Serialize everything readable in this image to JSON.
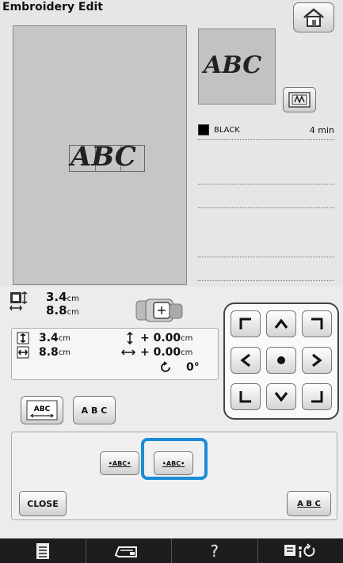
{
  "window": {
    "title": "Embroidery Edit"
  },
  "canvas": {
    "pattern_text": "ABC"
  },
  "preview": {
    "pattern_text": "ABC"
  },
  "thread_colors": [
    {
      "name": "BLACK",
      "time": "4 min",
      "color": "#000000"
    }
  ],
  "size_display": {
    "height_value": "3.4",
    "height_unit": "cm",
    "width_value": "8.8",
    "width_unit": "cm"
  },
  "edit_info": {
    "height_value": "3.4",
    "height_unit": "cm",
    "width_value": "8.8",
    "width_unit": "cm",
    "offset_v": "+ 0.00",
    "offset_v_unit": "cm",
    "offset_h": "+ 0.00",
    "offset_h_unit": "cm",
    "rotation": "0°"
  },
  "options": {
    "array_label": "ABC",
    "spacing_label": "A B C"
  },
  "spacing_buttons": {
    "decrease_label": "•ABC•",
    "increase_label": "•ABC•"
  },
  "buttons": {
    "close_label": "CLOSE",
    "abc_label": "A B C"
  },
  "bottom_bar": {
    "help_label": "?"
  },
  "colors": {
    "highlight": "#1a8cd8",
    "canvas": "#c6c6c6"
  }
}
